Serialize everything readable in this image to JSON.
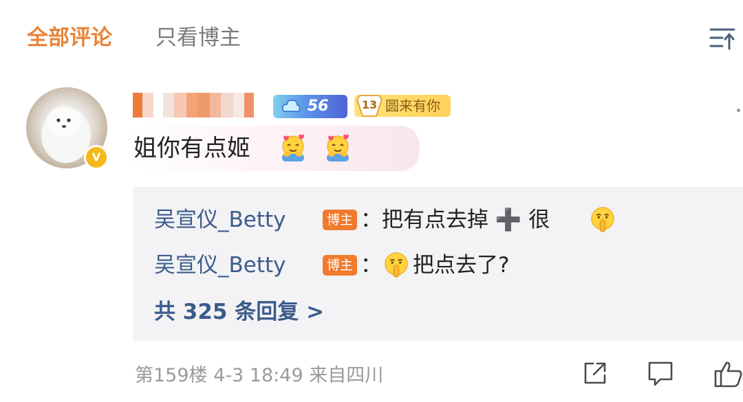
{
  "tabs": {
    "all_comments": "全部评论",
    "blogger_only": "只看博主"
  },
  "comment": {
    "verified_badge": "V",
    "level": "56",
    "fan_badge": {
      "level": "13",
      "name": "圆来有你"
    },
    "text": "姐你有点姬",
    "emojis": [
      "hug-emoji",
      "hug-emoji"
    ],
    "floor": "第159楼",
    "time": "4-3 18:49",
    "location": "来自四川"
  },
  "replies": [
    {
      "user": "吴宣仪_Betty",
      "tag": "博主",
      "text_before": "：把有点去掉 ➕ 很",
      "emoji": "shush-emoji",
      "text_after": ""
    },
    {
      "user": "吴宣仪_Betty",
      "tag": "博主",
      "text_before": "：",
      "emoji": "shush-emoji",
      "text_after": "把点去了?"
    }
  ],
  "more_replies": "共 325 条回复 >",
  "icons": {
    "sort": "sort-icon",
    "share": "share-icon",
    "comment": "comment-icon",
    "like": "like-icon"
  },
  "colors": {
    "accent_orange": "#e8843a",
    "link_blue": "#3b5b8c",
    "blogger_tag": "#f07a2e",
    "reply_bg": "#f3f3f5"
  }
}
